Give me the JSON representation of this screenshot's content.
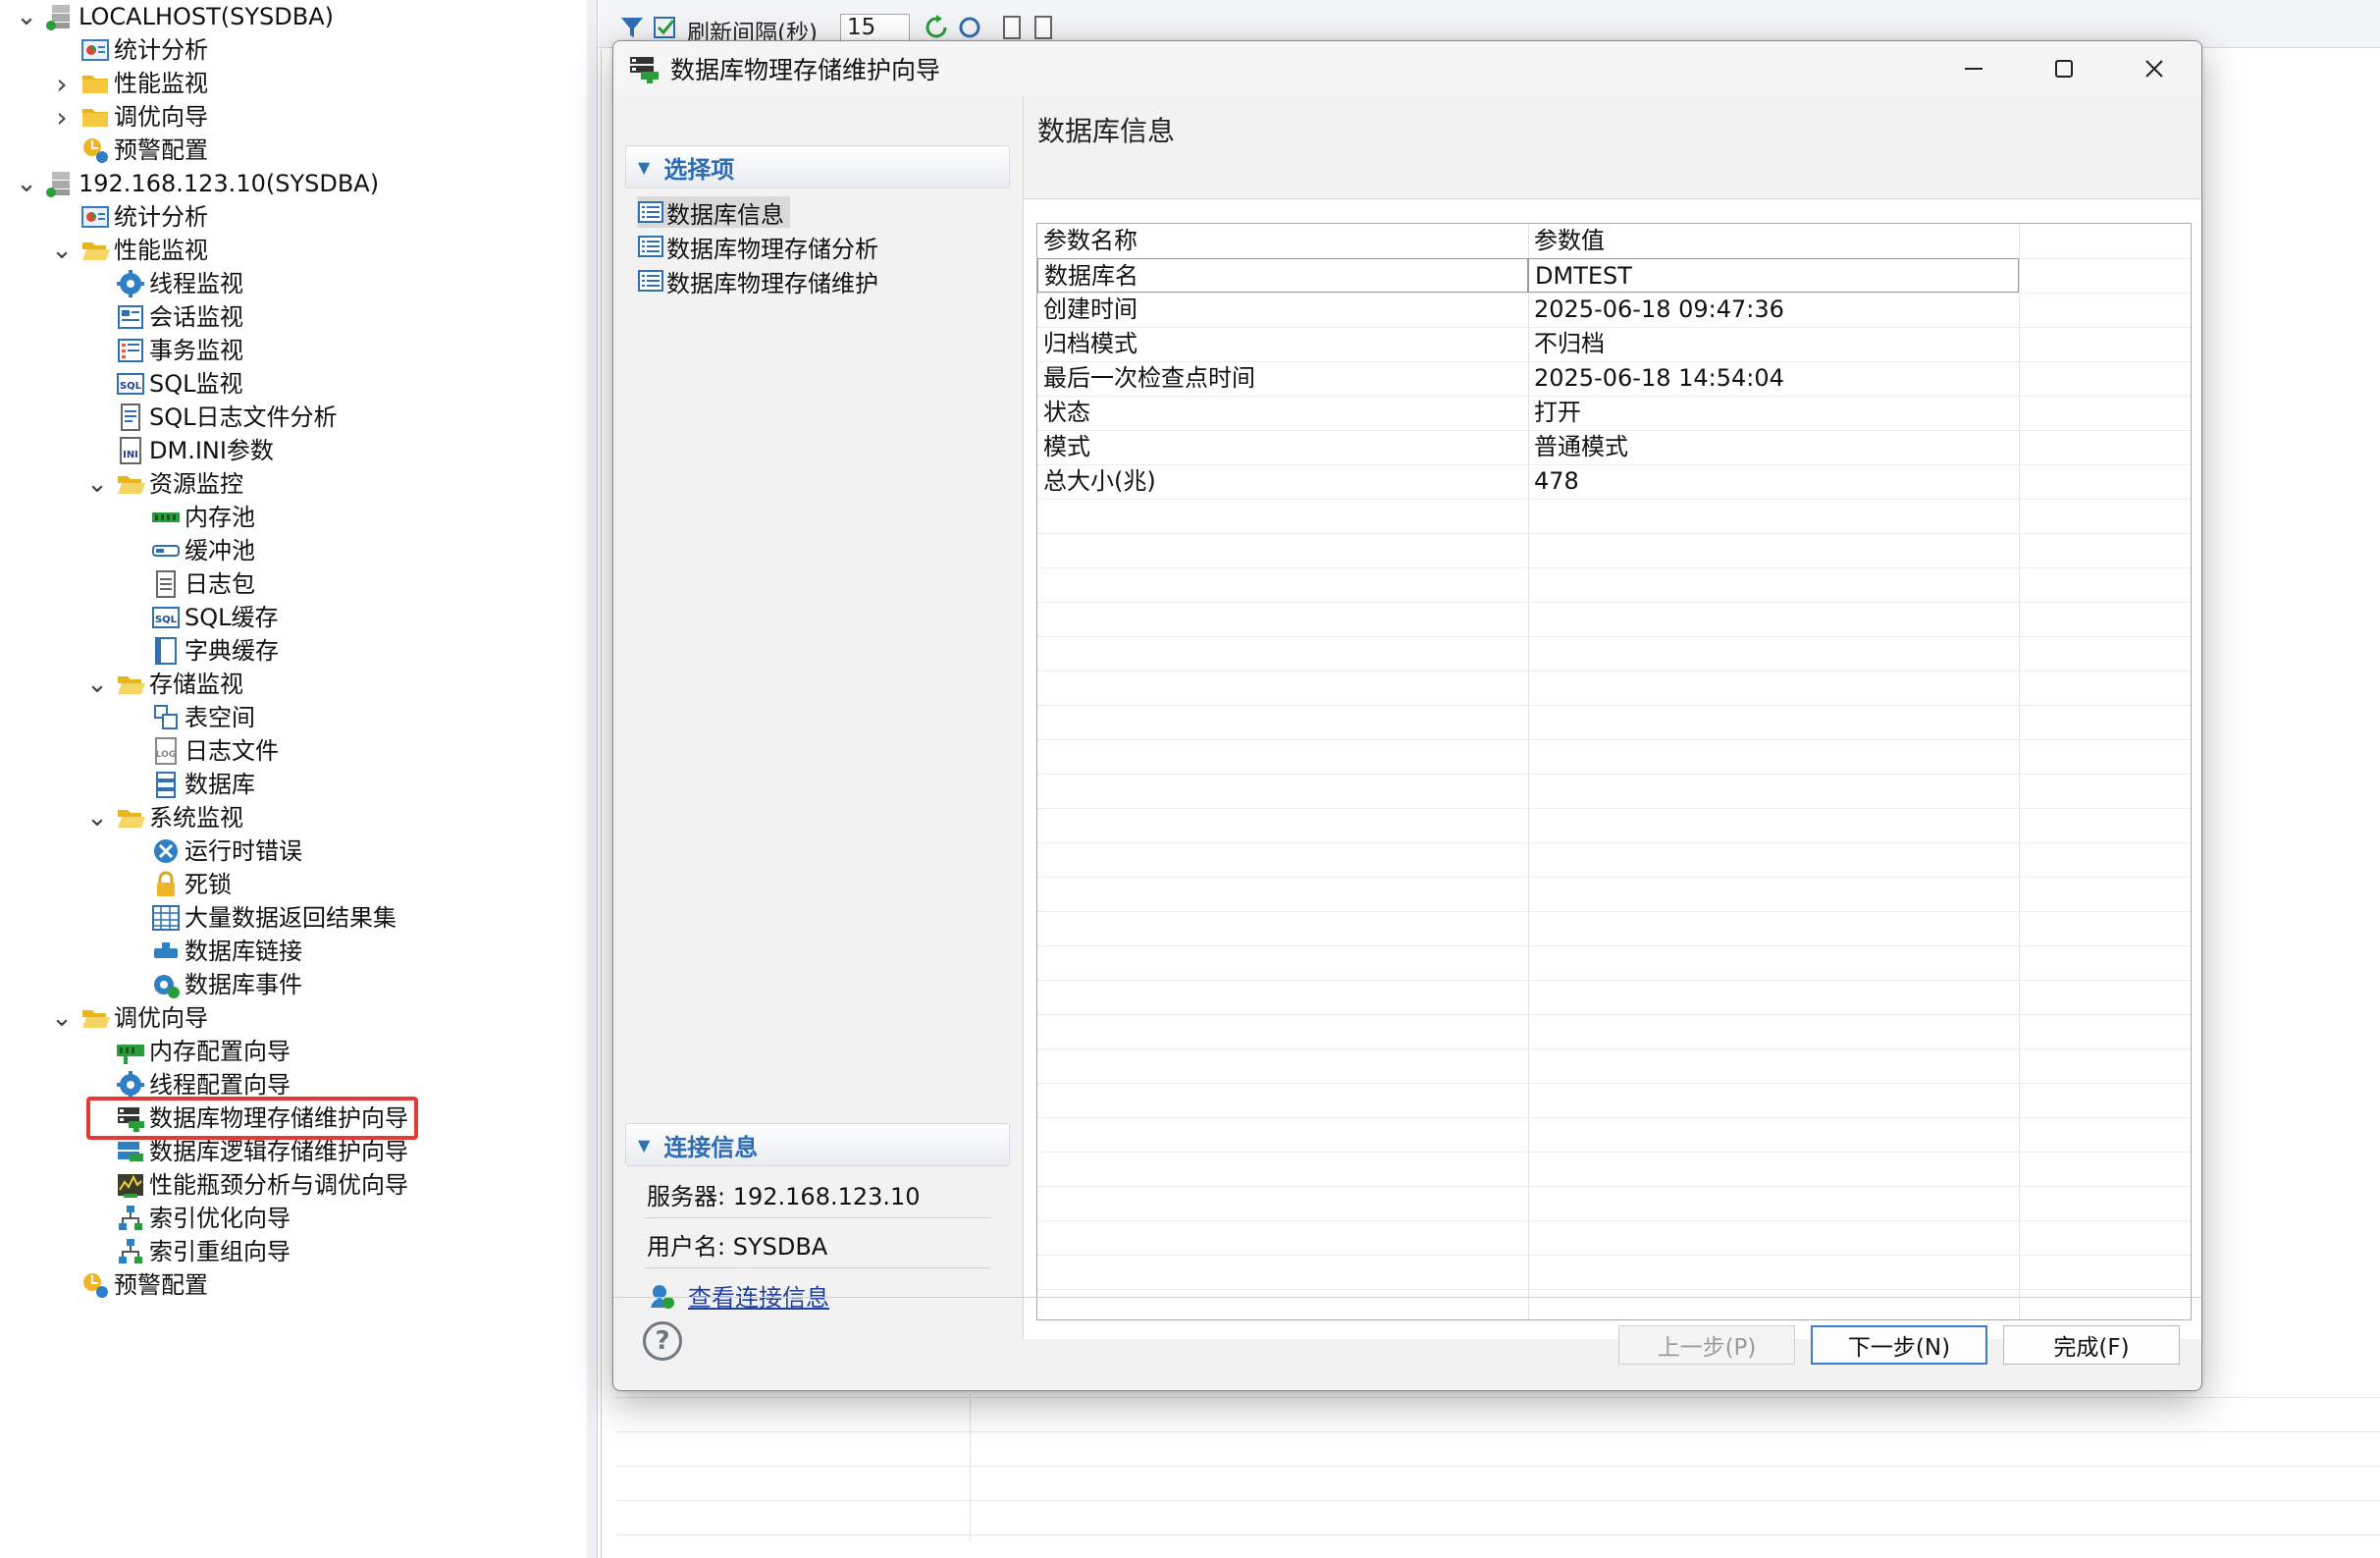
{
  "tree": {
    "items": [
      {
        "label": "LOCALHOST(SYSDBA)",
        "icon": "server-icon",
        "arrow": "down"
      },
      {
        "label": "统计分析",
        "icon": "stats-icon"
      },
      {
        "label": "性能监视",
        "icon": "folder-icon",
        "arrow": "right"
      },
      {
        "label": "调优向导",
        "icon": "folder-icon",
        "arrow": "right"
      },
      {
        "label": "预警配置",
        "icon": "alert-config-icon"
      },
      {
        "label": "192.168.123.10(SYSDBA)",
        "icon": "server-icon",
        "arrow": "down"
      },
      {
        "label": "统计分析",
        "icon": "stats-icon"
      },
      {
        "label": "性能监视",
        "icon": "folder-open-icon",
        "arrow": "down"
      },
      {
        "label": "线程监视",
        "icon": "gear-icon"
      },
      {
        "label": "会话监视",
        "icon": "session-icon"
      },
      {
        "label": "事务监视",
        "icon": "transaction-icon"
      },
      {
        "label": "SQL监视",
        "icon": "sql-icon"
      },
      {
        "label": "SQL日志文件分析",
        "icon": "sql-log-icon"
      },
      {
        "label": "DM.INI参数",
        "icon": "ini-icon"
      },
      {
        "label": "资源监控",
        "icon": "folder-open-icon",
        "arrow": "down"
      },
      {
        "label": "内存池",
        "icon": "memory-icon"
      },
      {
        "label": "缓冲池",
        "icon": "buffer-icon"
      },
      {
        "label": "日志包",
        "icon": "log-package-icon"
      },
      {
        "label": "SQL缓存",
        "icon": "sql-cache-icon"
      },
      {
        "label": "字典缓存",
        "icon": "dictionary-icon"
      },
      {
        "label": "存储监视",
        "icon": "folder-open-icon",
        "arrow": "down"
      },
      {
        "label": "表空间",
        "icon": "tablespace-icon"
      },
      {
        "label": "日志文件",
        "icon": "log-file-icon"
      },
      {
        "label": "数据库",
        "icon": "database-icon"
      },
      {
        "label": "系统监视",
        "icon": "folder-open-icon",
        "arrow": "down"
      },
      {
        "label": "运行时错误",
        "icon": "error-icon"
      },
      {
        "label": "死锁",
        "icon": "lock-icon"
      },
      {
        "label": "大量数据返回结果集",
        "icon": "table-icon"
      },
      {
        "label": "数据库链接",
        "icon": "link-icon"
      },
      {
        "label": "数据库事件",
        "icon": "event-icon"
      },
      {
        "label": "调优向导",
        "icon": "folder-open-icon",
        "arrow": "down"
      },
      {
        "label": "内存配置向导",
        "icon": "memory-wizard-icon"
      },
      {
        "label": "线程配置向导",
        "icon": "gear-icon"
      },
      {
        "label": "数据库物理存储维护向导",
        "icon": "physical-storage-icon"
      },
      {
        "label": "数据库逻辑存储维护向导",
        "icon": "logical-storage-icon"
      },
      {
        "label": "性能瓶颈分析与调优向导",
        "icon": "bottleneck-icon"
      },
      {
        "label": "索引优化向导",
        "icon": "index-icon"
      },
      {
        "label": "索引重组向导",
        "icon": "index-rebuild-icon"
      },
      {
        "label": "预警配置",
        "icon": "alert-config-icon"
      }
    ]
  },
  "toolbar": {
    "refresh_label": "刷新间隔(秒)",
    "refresh_value": "15"
  },
  "dialog": {
    "title": "数据库物理存储维护向导",
    "nav_section": "选择项",
    "nav_items": [
      {
        "label": "数据库信息",
        "selected": true
      },
      {
        "label": "数据库物理存储分析",
        "selected": false
      },
      {
        "label": "数据库物理存储维护",
        "selected": false
      }
    ],
    "conn_section": "连接信息",
    "server": "服务器: 192.168.123.10",
    "user": "用户名: SYSDBA",
    "view_conn": "查看连接信息",
    "content_title": "数据库信息",
    "table": {
      "headers": [
        "参数名称",
        "参数值"
      ],
      "rows": [
        [
          "数据库名",
          "DMTEST"
        ],
        [
          "创建时间",
          "2025-06-18 09:47:36"
        ],
        [
          "归档模式",
          "不归档"
        ],
        [
          "最后一次检查点时间",
          "2025-06-18 14:54:04"
        ],
        [
          "状态",
          "打开"
        ],
        [
          "模式",
          "普通模式"
        ],
        [
          "总大小(兆)",
          "478"
        ]
      ]
    },
    "buttons": {
      "prev": "上一步(P)",
      "next": "下一步(N)",
      "finish": "完成(F)"
    },
    "help_symbol": "?"
  },
  "colors": {
    "accent": "#2d6bb3",
    "highlight_border": "#e53935",
    "link": "#1f3f9a"
  }
}
